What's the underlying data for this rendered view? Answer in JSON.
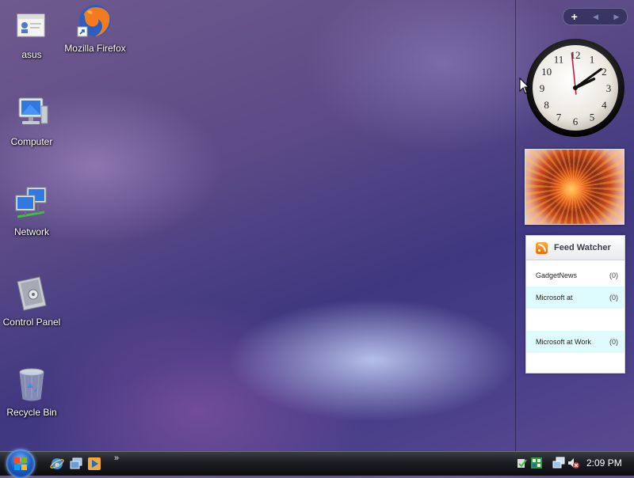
{
  "desktop": {
    "icons": [
      {
        "label": "asus",
        "icon": "user-folder-icon"
      },
      {
        "label": "Mozilla Firefox",
        "icon": "firefox-shortcut-icon"
      },
      {
        "label": "Computer",
        "icon": "computer-icon"
      },
      {
        "label": "Network",
        "icon": "network-icon"
      },
      {
        "label": "Control Panel",
        "icon": "control-panel-icon"
      },
      {
        "label": "Recycle Bin",
        "icon": "recycle-bin-icon"
      }
    ]
  },
  "sidebar": {
    "controls": {
      "add_label": "+",
      "prev_label": "◀",
      "next_label": "▶"
    },
    "clock": {
      "hour": 2,
      "minute": 9,
      "second": 59,
      "numerals": [
        "12",
        "1",
        "2",
        "3",
        "4",
        "5",
        "6",
        "7",
        "8",
        "9",
        "10",
        "11"
      ]
    },
    "slideshow": {
      "subject": "orange coneflower photo"
    },
    "feed_watcher": {
      "title": "Feed Watcher",
      "items": [
        {
          "name": "GadgetNews",
          "count": "(0)",
          "highlight": false
        },
        {
          "name": "Microsoft at",
          "count": "(0)",
          "highlight": true
        },
        {
          "name": "",
          "count": "",
          "highlight": false
        },
        {
          "name": "Microsoft at Work",
          "count": "(0)",
          "highlight": true
        },
        {
          "name": "",
          "count": "",
          "highlight": false
        }
      ]
    }
  },
  "taskbar": {
    "quick_launch": [
      "ie-icon",
      "switch-windows-icon",
      "media-player-icon"
    ],
    "overflow_label": "»",
    "tray_icons": [
      "security-icon",
      "network-status-icon",
      "volume-muted-icon"
    ],
    "time": "2:09 PM"
  },
  "colors": {
    "accent": "#1d5fc7",
    "feed_highlight": "#dffbfd",
    "clock_second_hand": "#c8102e"
  }
}
